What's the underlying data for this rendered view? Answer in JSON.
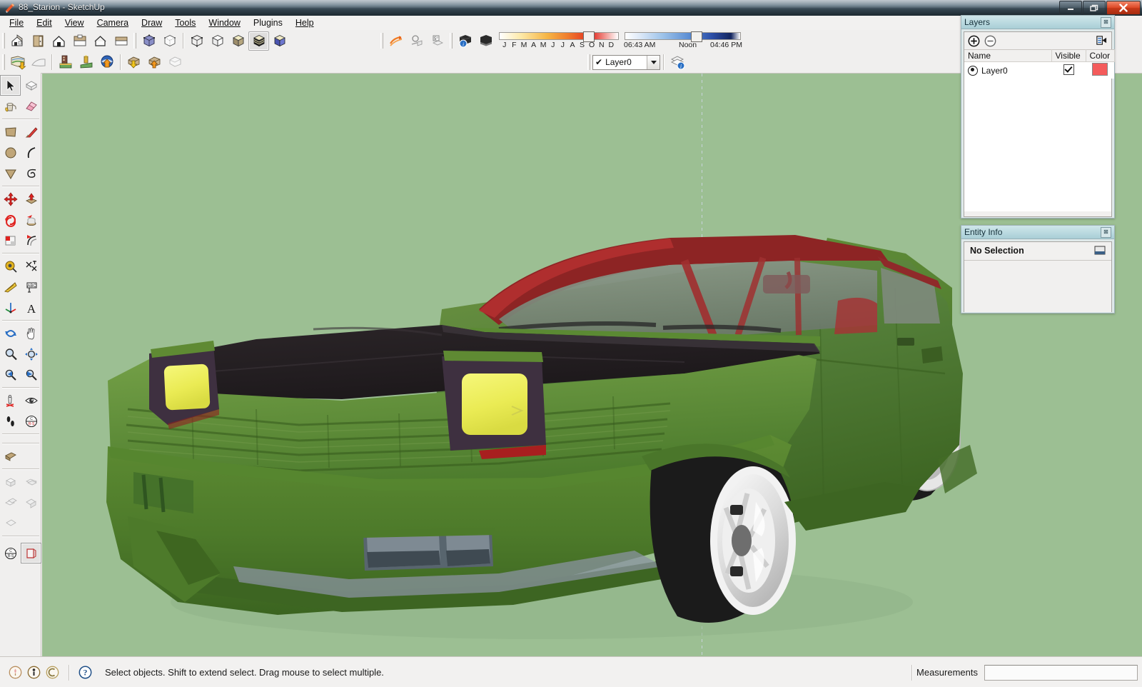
{
  "window": {
    "title": "88_Starion - SketchUp",
    "app_icon": "sketchup-icon",
    "minimize_label": "—",
    "restore_label": "❐",
    "close_label": "✕"
  },
  "menubar": {
    "items": [
      {
        "label": "File",
        "mnemonic": "F"
      },
      {
        "label": "Edit",
        "mnemonic": "E"
      },
      {
        "label": "View",
        "mnemonic": "V"
      },
      {
        "label": "Camera",
        "mnemonic": "C"
      },
      {
        "label": "Draw",
        "mnemonic": "r"
      },
      {
        "label": "Tools",
        "mnemonic": "T"
      },
      {
        "label": "Window",
        "mnemonic": "W"
      },
      {
        "label": "Plugins",
        "mnemonic": "P"
      },
      {
        "label": "Help",
        "mnemonic": "H"
      }
    ]
  },
  "toolbars": {
    "standard": [
      {
        "name": "new-button",
        "icon": "house-new-icon"
      },
      {
        "name": "open-button",
        "icon": "folder-open-icon"
      },
      {
        "name": "save-button",
        "icon": "house-save-icon"
      },
      {
        "name": "print-button",
        "icon": "print-icon"
      },
      {
        "name": "model-info-button",
        "icon": "house-outline-icon"
      },
      {
        "name": "erase-panel-button",
        "icon": "panel-icon"
      }
    ],
    "styles": [
      {
        "name": "style-xray-button",
        "icon": "cube-xray-icon"
      },
      {
        "name": "style-wireframe-button",
        "icon": "cube-wireframe-icon"
      },
      {
        "name": "style-hiddenline-button",
        "icon": "cube-hiddenline-icon"
      },
      {
        "name": "style-shaded-white-button",
        "icon": "cube-shaded-white-icon"
      },
      {
        "name": "style-shaded-button",
        "icon": "cube-shaded-icon"
      },
      {
        "name": "style-shaded-texture-button",
        "icon": "cube-texture-icon",
        "active": true
      },
      {
        "name": "style-monochrome-button",
        "icon": "cube-monochrome-icon"
      }
    ],
    "google": [
      {
        "name": "add-location-button",
        "icon": "map-download-icon"
      },
      {
        "name": "toggle-terrain-button",
        "icon": "terrain-icon"
      },
      {
        "name": "photo-texture-button",
        "icon": "photo-texture-icon"
      },
      {
        "name": "place-model-button",
        "icon": "place-model-icon"
      },
      {
        "name": "get-models-button",
        "icon": "globe-upload-icon"
      },
      {
        "name": "share-model-button",
        "icon": "model-download-icon"
      },
      {
        "name": "share-component-button",
        "icon": "model-upload-icon"
      },
      {
        "name": "preview-model-button",
        "icon": "preview-model-icon"
      }
    ],
    "sandbox": [
      {
        "name": "from-contours-button",
        "icon": "contours-icon"
      },
      {
        "name": "from-scratch-button",
        "icon": "from-scratch-icon"
      },
      {
        "name": "smoove-button",
        "icon": "smoove-icon"
      }
    ],
    "shadows": {
      "settings_button": {
        "name": "shadow-settings-button",
        "icon": "shadow-settings-icon"
      },
      "display_button": {
        "name": "display-shadows-button",
        "icon": "display-shadows-icon"
      },
      "month_letters": [
        "J",
        "F",
        "M",
        "A",
        "M",
        "J",
        "J",
        "A",
        "S",
        "O",
        "N",
        "D"
      ],
      "sunrise": "06:43 AM",
      "noon": "Noon",
      "sunset": "04:46 PM"
    },
    "layers_control": {
      "selected_layer": "Layer0",
      "check_glyph": "✔",
      "chevron_glyph": "▼",
      "layer_manager_button": {
        "name": "layer-manager-button",
        "icon": "layers-info-icon"
      }
    }
  },
  "left_toolbar": {
    "groups": [
      {
        "name": "principal",
        "tools": [
          {
            "name": "select-tool",
            "icon": "arrow-cursor-icon",
            "active": true
          },
          {
            "name": "make-component-tool",
            "icon": "component-icon"
          },
          {
            "name": "paint-bucket-tool",
            "icon": "paint-bucket-icon"
          },
          {
            "name": "eraser-tool",
            "icon": "eraser-icon"
          }
        ]
      },
      {
        "name": "drawing",
        "tools": [
          {
            "name": "rectangle-tool",
            "icon": "rectangle-icon"
          },
          {
            "name": "line-tool",
            "icon": "pencil-line-icon"
          },
          {
            "name": "circle-tool",
            "icon": "circle-icon"
          },
          {
            "name": "arc-tool",
            "icon": "arc-icon"
          },
          {
            "name": "polygon-tool",
            "icon": "polygon-icon"
          },
          {
            "name": "freehand-tool",
            "icon": "freehand-icon"
          }
        ]
      },
      {
        "name": "modification",
        "tools": [
          {
            "name": "move-tool",
            "icon": "move-cross-icon"
          },
          {
            "name": "push-pull-tool",
            "icon": "push-pull-icon"
          },
          {
            "name": "rotate-tool",
            "icon": "rotate-icon"
          },
          {
            "name": "follow-me-tool",
            "icon": "follow-me-icon"
          },
          {
            "name": "scale-tool",
            "icon": "scale-icon"
          },
          {
            "name": "offset-tool",
            "icon": "offset-icon"
          }
        ]
      },
      {
        "name": "construction",
        "tools": [
          {
            "name": "tape-measure-tool",
            "icon": "tape-measure-icon"
          },
          {
            "name": "dimension-tool",
            "icon": "dimension-icon"
          },
          {
            "name": "protractor-tool",
            "icon": "protractor-icon"
          },
          {
            "name": "text-tool",
            "icon": "text-label-icon"
          },
          {
            "name": "axes-tool",
            "icon": "axes-icon"
          },
          {
            "name": "3d-text-tool",
            "icon": "3d-text-icon"
          }
        ]
      },
      {
        "name": "camera",
        "tools": [
          {
            "name": "orbit-tool",
            "icon": "orbit-icon"
          },
          {
            "name": "pan-tool",
            "icon": "hand-pan-icon"
          },
          {
            "name": "zoom-tool",
            "icon": "magnifier-icon"
          },
          {
            "name": "zoom-extents-tool",
            "icon": "zoom-extents-icon"
          },
          {
            "name": "previous-view-tool",
            "icon": "previous-view-icon"
          },
          {
            "name": "next-view-tool",
            "icon": "next-view-icon"
          }
        ]
      },
      {
        "name": "walkthrough",
        "tools": [
          {
            "name": "position-camera-tool",
            "icon": "position-camera-icon"
          },
          {
            "name": "look-around-tool",
            "icon": "eye-look-icon"
          },
          {
            "name": "walk-tool",
            "icon": "footprints-icon"
          },
          {
            "name": "section-plane-tool",
            "icon": "section-plane-icon"
          }
        ]
      },
      {
        "name": "sections",
        "tools": [
          {
            "name": "section-display-tool",
            "icon": "section-fill-icon"
          }
        ]
      },
      {
        "name": "views",
        "tools": [
          {
            "name": "iso-view-button",
            "icon": "iso-view-icon"
          },
          {
            "name": "top-view-button",
            "icon": "top-view-icon"
          },
          {
            "name": "front-view-button",
            "icon": "front-view-icon"
          },
          {
            "name": "right-view-button",
            "icon": "right-view-icon"
          },
          {
            "name": "back-view-button",
            "icon": "back-view-icon"
          }
        ]
      },
      {
        "name": "section-plane-group",
        "tools": [
          {
            "name": "display-section-planes-button",
            "icon": "section-plane-toggle-icon"
          },
          {
            "name": "display-section-cuts-button",
            "icon": "section-cut-icon",
            "active": true
          }
        ]
      }
    ]
  },
  "viewport": {
    "name": "model-viewport",
    "background_color": "#9cbf93",
    "model_title": "88_Starion",
    "colors": {
      "body_green": "#4a7a28",
      "body_green_dark": "#35591c",
      "body_green_light": "#6f9a44",
      "hood_dark": "#241f22",
      "interior_red": "#8f2b2b",
      "glass": "#7d8a7c",
      "headlight_yellow": "#edee5b",
      "headlight_housing": "#3e3040",
      "wheel_white": "#e8e8e8",
      "tire_black": "#1b1b1b",
      "trim_gray": "#8a929a"
    }
  },
  "panels": {
    "layers": {
      "title": "Layers",
      "close_glyph": "⊠",
      "add_button_label": "+",
      "remove_button_label": "−",
      "details_button": "details-flyout-icon",
      "columns": [
        "Name",
        "Visible",
        "Color"
      ],
      "rows": [
        {
          "name": "Layer0",
          "visible": true,
          "color": "#f45b5b",
          "active": true
        }
      ]
    },
    "entity_info": {
      "title": "Entity Info",
      "close_glyph": "⊠",
      "selection_text": "No Selection",
      "expand_button": "expand-icon"
    }
  },
  "statusbar": {
    "icons": [
      {
        "name": "context-help-icon",
        "glyph": "?"
      },
      {
        "name": "instructor-icon",
        "glyph": "i"
      },
      {
        "name": "credits-icon",
        "glyph": "C"
      }
    ],
    "help_icon": {
      "name": "help-circle-icon",
      "glyph": "?"
    },
    "message": "Select objects. Shift to extend select. Drag mouse to select multiple.",
    "measurements_label": "Measurements",
    "measurements_value": ""
  }
}
